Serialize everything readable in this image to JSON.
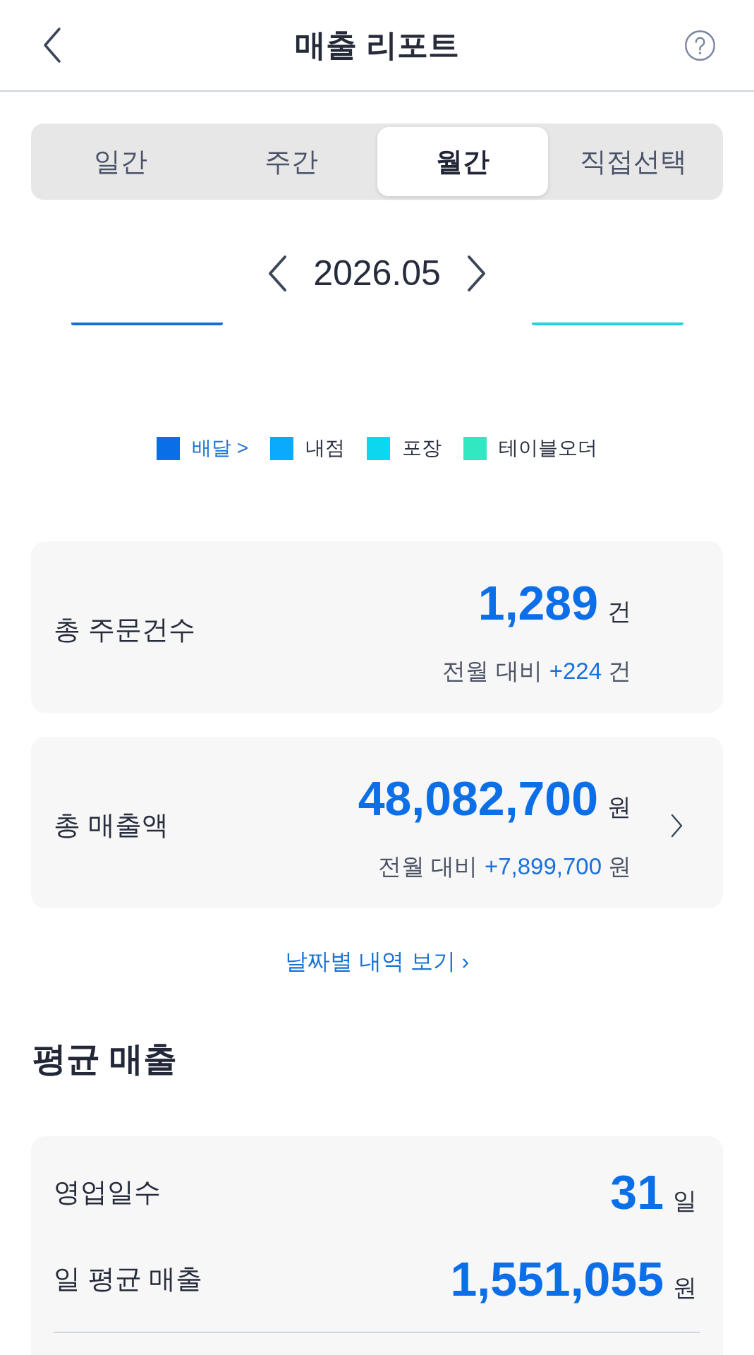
{
  "header": {
    "title": "매출 리포트"
  },
  "period_tabs": [
    {
      "label": "일간",
      "selected": false
    },
    {
      "label": "주간",
      "selected": false
    },
    {
      "label": "월간",
      "selected": true
    },
    {
      "label": "직접선택",
      "selected": false
    }
  ],
  "date_nav": {
    "label": "2026.05"
  },
  "chart_bars": [
    {
      "color": "#1570dc"
    },
    {
      "color": "#1fd2e6"
    }
  ],
  "legend": [
    {
      "label": "배달 >",
      "color": "#0a6ee8",
      "selected": true
    },
    {
      "label": "내점",
      "color": "#0aaaff",
      "selected": false
    },
    {
      "label": "포장",
      "color": "#0bd8ee",
      "selected": false
    },
    {
      "label": "테이블오더",
      "color": "#32e8c2",
      "selected": false
    }
  ],
  "summary_cards": [
    {
      "label": "총 주문건수",
      "value": "1,289",
      "unit": "건",
      "comparison": {
        "label": "전월 대비",
        "change": "+224",
        "unit": "건"
      },
      "navigable": false
    },
    {
      "label": "총 매출액",
      "value": "48,082,700",
      "unit": "원",
      "comparison": {
        "label": "전월 대비",
        "change": "+7,899,700",
        "unit": "원"
      },
      "navigable": true
    }
  ],
  "daily_link": "날짜별 내역 보기 ›",
  "average_section": {
    "title": "평균 매출",
    "rows": [
      {
        "label": "영업일수",
        "value": "31",
        "unit": "일"
      },
      {
        "label": "일 평균 매출",
        "value": "1,551,055",
        "unit": "원"
      }
    ]
  }
}
